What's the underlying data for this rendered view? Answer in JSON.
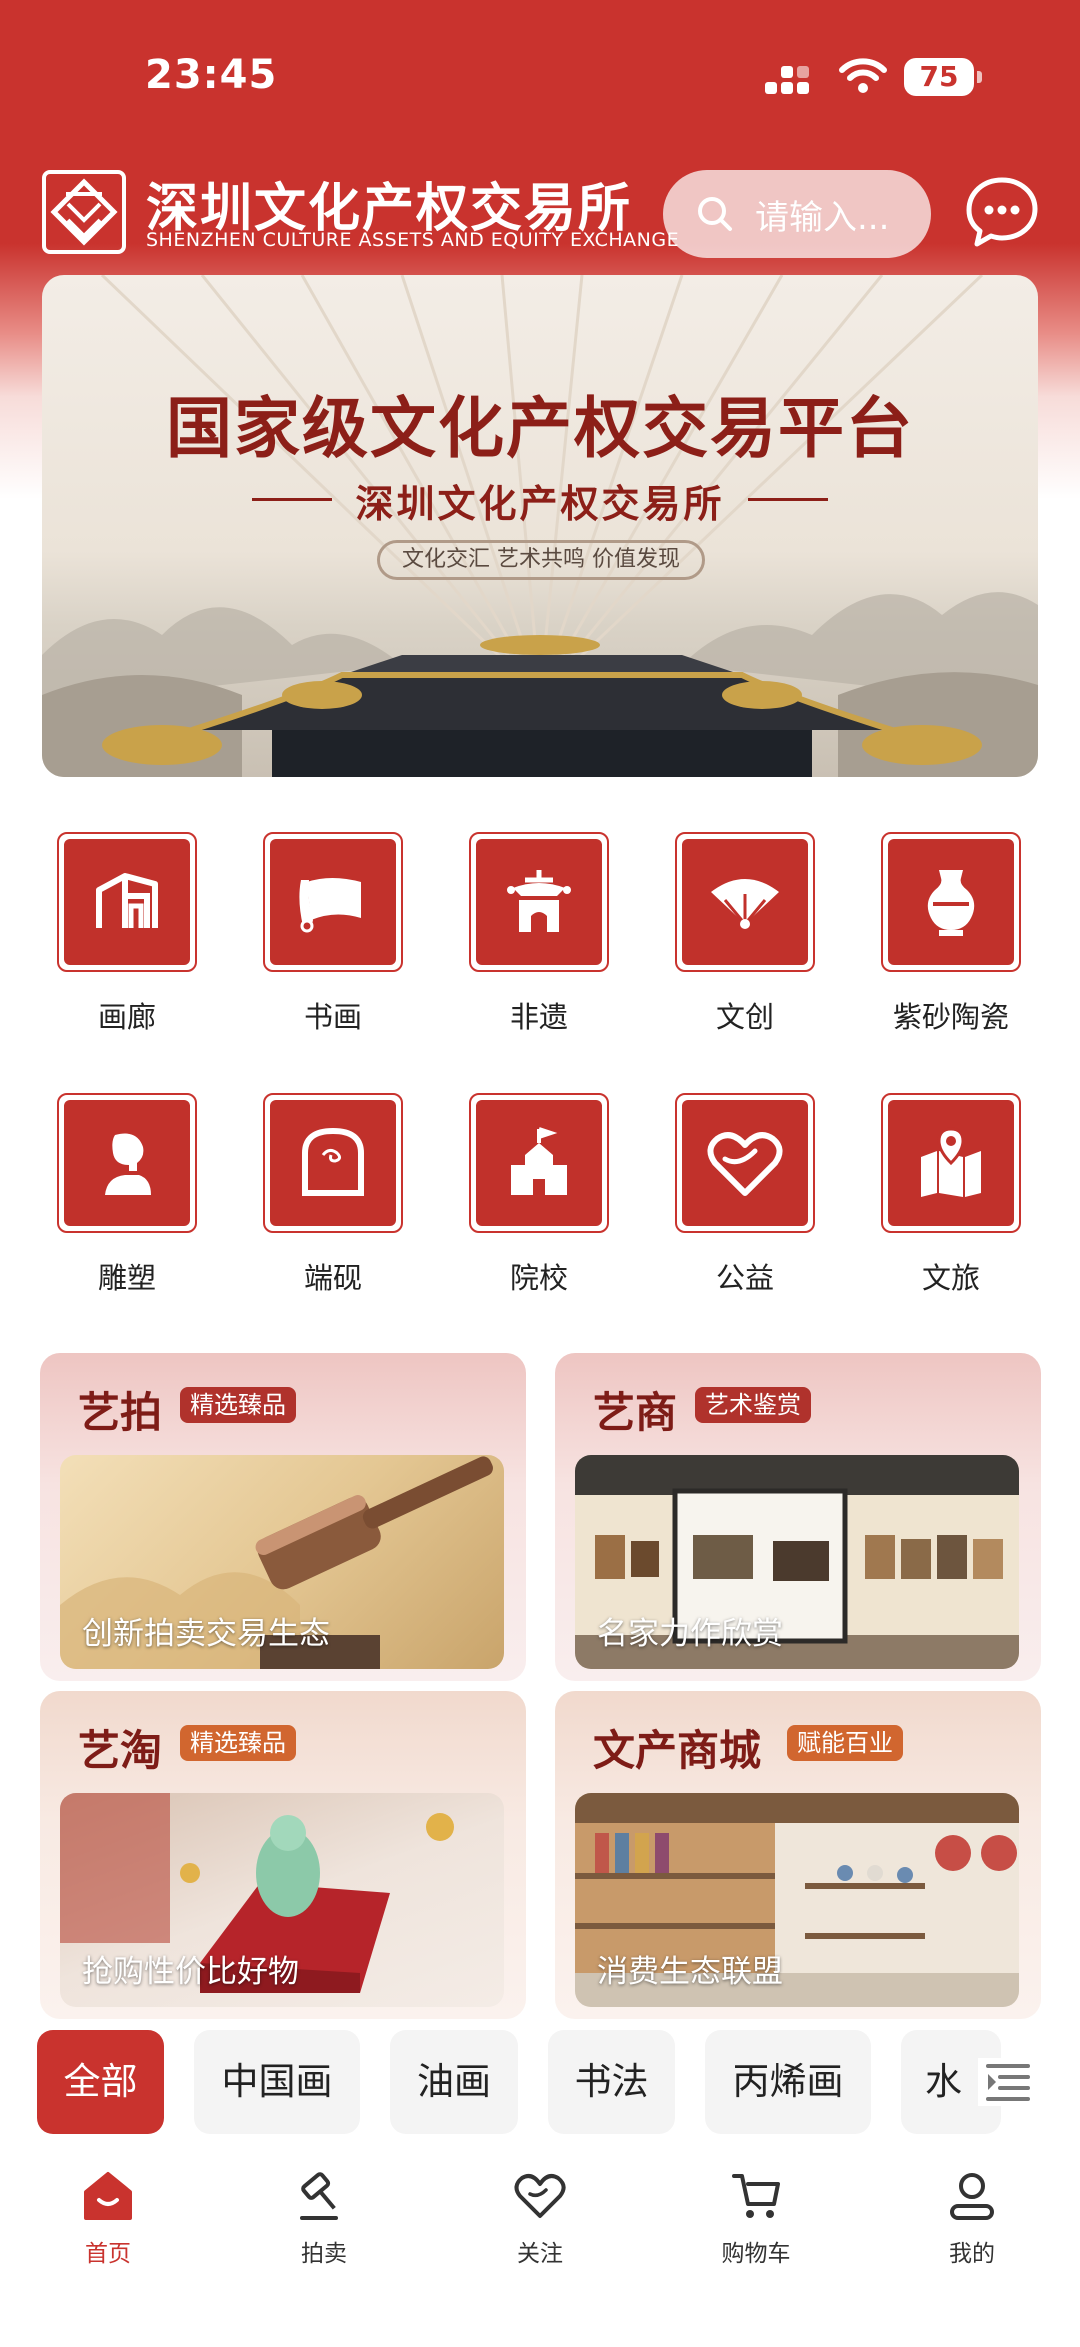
{
  "status_bar": {
    "time": "23:45",
    "battery": "75"
  },
  "header": {
    "brand_cn": "深圳文化产权交易所",
    "brand_en": "SHENZHEN CULTURE ASSETS AND EQUITY EXCHANGE",
    "search_placeholder": "请输入..."
  },
  "banner": {
    "title": "国家级文化产权交易平台",
    "subtitle": "深圳文化产权交易所",
    "tagline": "文化交汇 艺术共鸣 价值发现"
  },
  "categories": [
    {
      "label": "画廊",
      "icon": "gallery-icon"
    },
    {
      "label": "书画",
      "icon": "scroll-icon"
    },
    {
      "label": "非遗",
      "icon": "heritage-icon"
    },
    {
      "label": "文创",
      "icon": "fan-icon"
    },
    {
      "label": "紫砂陶瓷",
      "icon": "vase-icon"
    },
    {
      "label": "雕塑",
      "icon": "sculpture-icon"
    },
    {
      "label": "端砚",
      "icon": "inkstone-icon"
    },
    {
      "label": "院校",
      "icon": "school-icon"
    },
    {
      "label": "公益",
      "icon": "heart-icon"
    },
    {
      "label": "文旅",
      "icon": "map-pin-icon"
    }
  ],
  "cards": [
    {
      "title": "艺拍",
      "badge": "精选臻品",
      "caption": "创新拍卖交易生态"
    },
    {
      "title": "艺商",
      "badge": "艺术鉴赏",
      "caption": "名家力作欣赏"
    },
    {
      "title": "艺淘",
      "badge": "精选臻品",
      "caption": "抢购性价比好物"
    },
    {
      "title": "文产商城",
      "badge": "赋能百业",
      "caption": "消费生态联盟"
    }
  ],
  "filters": [
    "全部",
    "中国画",
    "油画",
    "书法",
    "丙烯画",
    "水"
  ],
  "nav": [
    {
      "label": "首页",
      "icon": "home-icon"
    },
    {
      "label": "拍卖",
      "icon": "gavel-icon"
    },
    {
      "label": "关注",
      "icon": "heart-outline-icon"
    },
    {
      "label": "购物车",
      "icon": "cart-icon"
    },
    {
      "label": "我的",
      "icon": "profile-icon"
    }
  ],
  "colors": {
    "primary": "#c9332e",
    "banner_text": "#8c1f18",
    "card_title": "#7e1c17"
  }
}
